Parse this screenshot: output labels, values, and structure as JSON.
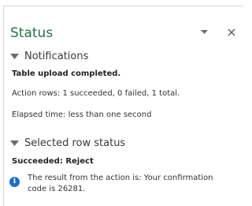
{
  "pane": {
    "title": "Status"
  },
  "notifications": {
    "heading": "Notifications",
    "summary": "Table upload completed.",
    "action_rows": "Action rows: 1 succeeded, 0 failed, 1 total.",
    "elapsed": "Elapsed time: less than one second"
  },
  "selected_row": {
    "heading": "Selected row status",
    "status": "Succeeded: Reject",
    "message": "The result from the action is: Your confirmation code is 26281."
  },
  "icons": {
    "dropdown": "chevron-down-icon",
    "close": "close-icon",
    "collapse": "triangle-down-icon",
    "info": "info-icon"
  },
  "colors": {
    "title": "#217346",
    "info": "#1e6fc2"
  }
}
